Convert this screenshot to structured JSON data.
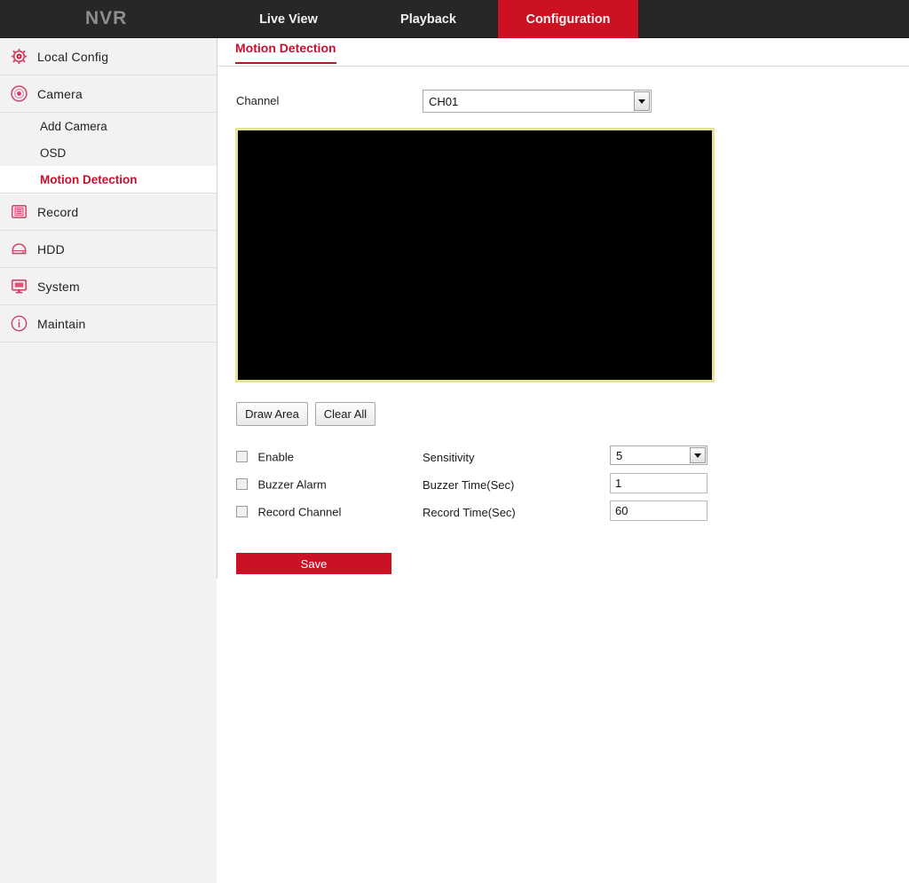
{
  "topbar": {
    "brand": "NVR",
    "tabs": [
      {
        "label": "Live View",
        "active": false
      },
      {
        "label": "Playback",
        "active": false
      },
      {
        "label": "Configuration",
        "active": true
      }
    ],
    "background_color": "#272727",
    "active_tab_color": "#cc1122"
  },
  "sidebar": {
    "items": [
      {
        "label": "Local Config",
        "icon": "gear-icon"
      },
      {
        "label": "Camera",
        "icon": "camera-lens-icon"
      }
    ],
    "camera_submenu": [
      {
        "label": "Add Camera",
        "active": false
      },
      {
        "label": "OSD",
        "active": false
      },
      {
        "label": "Motion Detection",
        "active": true
      }
    ],
    "items_lower": [
      {
        "label": "Record",
        "icon": "record-icon"
      },
      {
        "label": "HDD",
        "icon": "hdd-icon"
      },
      {
        "label": "System",
        "icon": "monitor-icon"
      },
      {
        "label": "Maintain",
        "icon": "info-circle-icon"
      }
    ],
    "active_color": "#c8102e"
  },
  "main": {
    "page_tab": "Motion Detection",
    "channel": {
      "label": "Channel",
      "value": "CH01"
    },
    "preview": {
      "border_color": "#e3e39a",
      "background_color": "#000000"
    },
    "buttons": {
      "draw_area": "Draw Area",
      "clear_all": "Clear All",
      "save": "Save"
    },
    "options": [
      {
        "label": "Enable",
        "checked": false
      },
      {
        "label": "Buzzer Alarm",
        "checked": false
      },
      {
        "label": "Record Channel",
        "checked": false
      }
    ],
    "fields": [
      {
        "label": "Sensitivity",
        "value": "5",
        "type": "select"
      },
      {
        "label": "Buzzer Time(Sec)",
        "value": "1",
        "type": "text"
      },
      {
        "label": "Record Time(Sec)",
        "value": "60",
        "type": "text"
      }
    ],
    "save_color": "#cc1127"
  }
}
